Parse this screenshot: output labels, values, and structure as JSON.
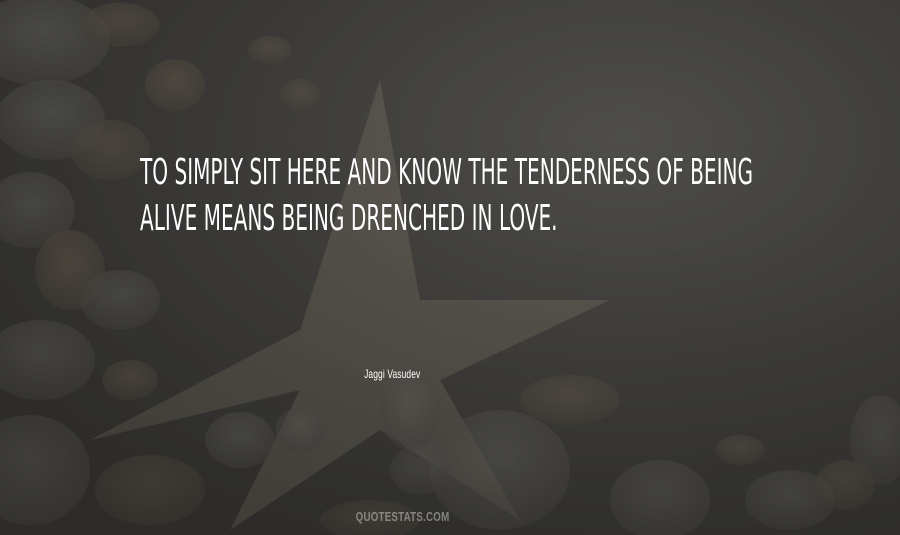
{
  "quote": {
    "text": "To simply sit here and know the tenderness of being alive means being drenched in love."
  },
  "author": {
    "name": "Jaggi Vasudev"
  },
  "watermark": {
    "text": "QUOTESTATS.COM"
  },
  "colors": {
    "background": "#4a4845",
    "text": "#ffffff",
    "watermark": "#c8c6c2"
  }
}
